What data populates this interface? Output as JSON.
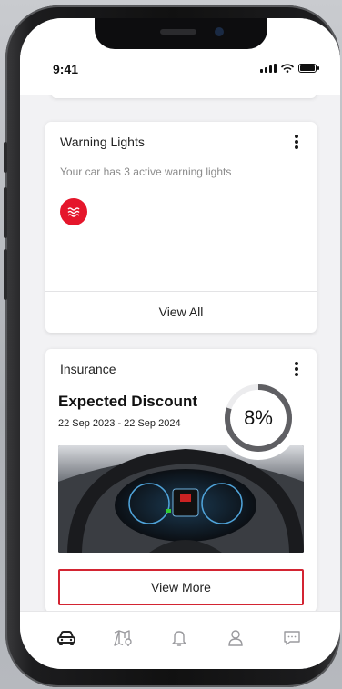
{
  "status_bar": {
    "time": "9:41",
    "icons": [
      "signal-icon",
      "wifi-icon",
      "battery-icon"
    ]
  },
  "warning_card": {
    "title": "Warning Lights",
    "subtitle": "Your car has 3 active warning lights",
    "indicator_icon": "warning-lights-icon",
    "action_label": "View All"
  },
  "insurance_card": {
    "title": "Insurance",
    "heading": "Expected Discount",
    "date_range": "22 Sep 2023 - 22 Sep 2024",
    "discount_label": "8%",
    "discount_fraction": 0.8,
    "image": "car-dashboard-photo",
    "action_label": "View More"
  },
  "tab_bar": {
    "tabs": [
      {
        "icon": "car-icon",
        "active": true
      },
      {
        "icon": "map-icon",
        "active": false
      },
      {
        "icon": "bell-icon",
        "active": false
      },
      {
        "icon": "profile-icon",
        "active": false
      },
      {
        "icon": "chat-icon",
        "active": false
      }
    ]
  },
  "colors": {
    "accent_red": "#e5162b",
    "outline_red": "#d32432",
    "ring": "#5f5f63",
    "text": "#222222"
  }
}
